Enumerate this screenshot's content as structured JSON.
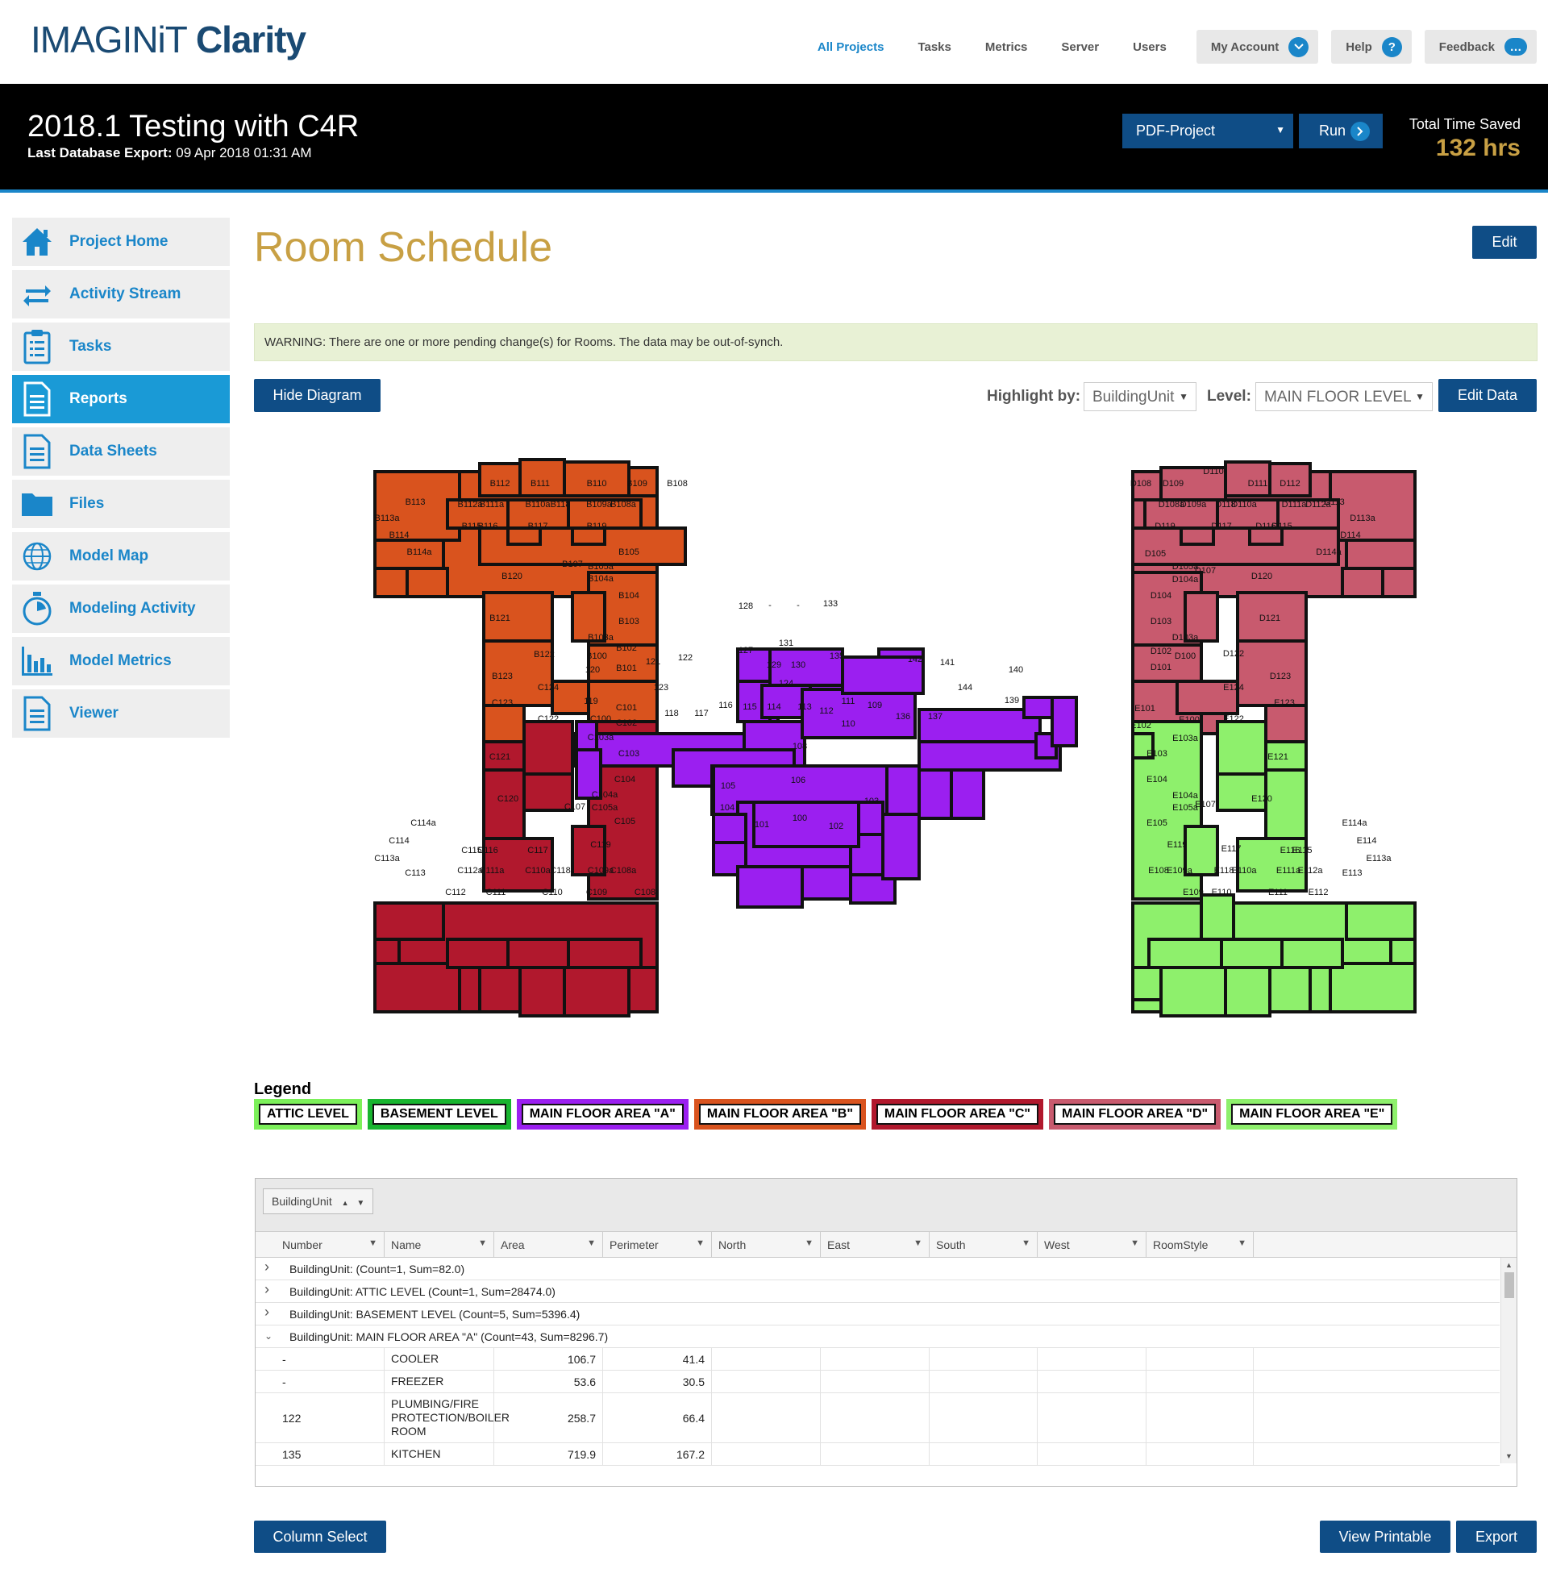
{
  "logo": {
    "light": "IMAGINiT",
    "bold": "Clarity"
  },
  "topnav": {
    "links": [
      "All Projects",
      "Tasks",
      "Metrics",
      "Server",
      "Users"
    ],
    "my_account": "My Account",
    "help": "Help",
    "help_glyph": "?",
    "feedback": "Feedback",
    "feedback_glyph": "…"
  },
  "project": {
    "title": "2018.1 Testing with C4R",
    "export_label": "Last Database Export:",
    "export_value": "09 Apr 2018 01:31 AM",
    "dropdown_value": "PDF-Project",
    "run_label": "Run",
    "time_saved_label": "Total Time Saved",
    "time_saved_value": "132 hrs"
  },
  "sidebar": {
    "items": [
      {
        "label": "Project Home",
        "icon": "home-icon"
      },
      {
        "label": "Activity Stream",
        "icon": "swap-arrows-icon"
      },
      {
        "label": "Tasks",
        "icon": "clipboard-icon"
      },
      {
        "label": "Reports",
        "icon": "report-icon",
        "active": true
      },
      {
        "label": "Data Sheets",
        "icon": "document-icon"
      },
      {
        "label": "Files",
        "icon": "folder-icon"
      },
      {
        "label": "Model Map",
        "icon": "globe-icon"
      },
      {
        "label": "Modeling Activity",
        "icon": "stopwatch-icon"
      },
      {
        "label": "Model Metrics",
        "icon": "bar-chart-icon"
      },
      {
        "label": "Viewer",
        "icon": "document-icon"
      }
    ]
  },
  "page": {
    "title": "Room Schedule",
    "edit_label": "Edit",
    "warning": "WARNING: There are one or more pending change(s) for Rooms. The data may be out-of-synch.",
    "hide_diagram_label": "Hide Diagram",
    "highlight_label": "Highlight by:",
    "highlight_value": "BuildingUnit",
    "level_label": "Level:",
    "level_value": "MAIN FLOOR LEVEL",
    "edit_data_label": "Edit Data"
  },
  "colors": {
    "area_a": "#9b1ff0",
    "area_b": "#d9531e",
    "area_c": "#b1182d",
    "area_d": "#c85a6e",
    "area_e": "#8ef06c",
    "attic": "#7cf05a",
    "basement": "#18b52f",
    "accent": "#1a86c9",
    "navy": "#0f4d86",
    "gold": "#c8a044"
  },
  "legend": {
    "title": "Legend",
    "items": [
      {
        "label": "ATTIC LEVEL",
        "color": "#7cf05a"
      },
      {
        "label": "BASEMENT LEVEL",
        "color": "#18b52f"
      },
      {
        "label": "MAIN FLOOR AREA \"A\"",
        "color": "#9b1ff0"
      },
      {
        "label": "MAIN FLOOR AREA \"B\"",
        "color": "#d9531e"
      },
      {
        "label": "MAIN FLOOR AREA \"C\"",
        "color": "#b1182d"
      },
      {
        "label": "MAIN FLOOR AREA \"D\"",
        "color": "#c85a6e"
      },
      {
        "label": "MAIN FLOOR AREA \"E\"",
        "color": "#8ef06c"
      }
    ]
  },
  "grid": {
    "group_chip": "BuildingUnit",
    "columns": [
      "Number",
      "Name",
      "Area",
      "Perimeter",
      "North",
      "East",
      "South",
      "West",
      "RoomStyle"
    ],
    "groups": [
      "BuildingUnit: (Count=1, Sum=82.0)",
      "BuildingUnit: ATTIC LEVEL (Count=1, Sum=28474.0)",
      "BuildingUnit: BASEMENT LEVEL (Count=5, Sum=5396.4)",
      "BuildingUnit: MAIN FLOOR AREA \"A\" (Count=43, Sum=8296.7)"
    ],
    "rows": [
      {
        "number": "-",
        "name": "COOLER",
        "area": "106.7",
        "perimeter": "41.4"
      },
      {
        "number": "-",
        "name": "FREEZER",
        "area": "53.6",
        "perimeter": "30.5"
      },
      {
        "number": "122",
        "name": "PLUMBING/FIRE PROTECTION/BOILER ROOM",
        "area": "258.7",
        "perimeter": "66.4"
      },
      {
        "number": "135",
        "name": "KITCHEN",
        "area": "719.9",
        "perimeter": "167.2"
      }
    ]
  },
  "footer": {
    "column_select": "Column Select",
    "view_printable": "View Printable",
    "export": "Export"
  },
  "plan": {
    "labels_a": [
      "128",
      "-",
      "-",
      "133",
      "131",
      "127",
      "129",
      "130",
      "135",
      "122",
      "121",
      "123",
      "124",
      "142",
      "141",
      "144",
      "120",
      "119",
      "118",
      "117",
      "116",
      "115",
      "114",
      "113",
      "112",
      "111",
      "110",
      "109",
      "136",
      "137",
      "108",
      "106",
      "105",
      "104",
      "101",
      "100",
      "102",
      "103",
      "140",
      "139"
    ],
    "labels_b": [
      "B112",
      "B111",
      "B110",
      "B109",
      "B108",
      "B113",
      "B113a",
      "B112a",
      "B111a",
      "B110a",
      "B118",
      "B109a",
      "B108a",
      "B115",
      "B116",
      "B117",
      "B119",
      "B114",
      "B114a",
      "B105",
      "B107",
      "B105a",
      "B104a",
      "B104",
      "B120",
      "B121",
      "B103",
      "B103a",
      "B122",
      "B100",
      "B102",
      "B101",
      "B123"
    ],
    "labels_c": [
      "C124",
      "C123",
      "C122",
      "C101",
      "C100",
      "C102",
      "C103a",
      "C103",
      "C121",
      "C104",
      "C104a",
      "C107",
      "C105a",
      "C105",
      "C120",
      "C114a",
      "C114",
      "C119",
      "C113a",
      "C113",
      "C115",
      "C116",
      "C117",
      "C112a",
      "C111a",
      "C110a",
      "C118",
      "C109a",
      "C108a",
      "C112",
      "C111",
      "C110",
      "C109",
      "C108"
    ],
    "labels_d": [
      "D108",
      "D109",
      "D110",
      "D111",
      "D112",
      "D113",
      "D108a",
      "D109a",
      "D118",
      "D110a",
      "D111a",
      "D112a",
      "D113a",
      "D119",
      "D117",
      "D116",
      "D115",
      "D114",
      "D114a",
      "D105",
      "D105a",
      "D107",
      "D104a",
      "D104",
      "D120",
      "D103",
      "D121",
      "D103a",
      "D102",
      "D100",
      "D122",
      "D101",
      "D123"
    ],
    "labels_e": [
      "E124",
      "E123",
      "E101",
      "E100",
      "E102",
      "E103a",
      "E122",
      "E103",
      "E121",
      "E104",
      "E104a",
      "E107",
      "E105a",
      "E105",
      "E120",
      "E114a",
      "E114",
      "E119",
      "E117",
      "E116",
      "E115",
      "E113a",
      "E108",
      "E109a",
      "E118",
      "E110a",
      "E111a",
      "E112a",
      "E113",
      "E109",
      "E110",
      "E111",
      "E112"
    ]
  }
}
